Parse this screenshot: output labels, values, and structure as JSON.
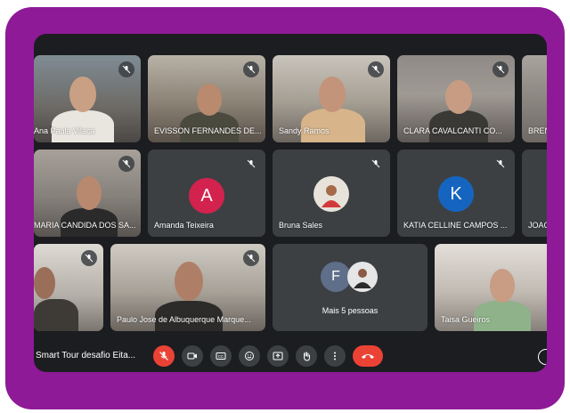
{
  "participants": {
    "row1": [
      {
        "name": "Ana Paula Vilaca"
      },
      {
        "name": "EVISSON FERNANDES DE..."
      },
      {
        "name": "Sandy Ramos"
      },
      {
        "name": "CLARA CAVALCANTI CO..."
      },
      {
        "name": "BREN"
      }
    ],
    "row2": [
      {
        "name": "MARIA CANDIDA DOS SA..."
      },
      {
        "name": "Amanda Teixeira",
        "initial": "A",
        "avatar_color": "#d3224e"
      },
      {
        "name": "Bruna Sales"
      },
      {
        "name": "KATIA CELLINE CAMPOS ...",
        "initial": "K",
        "avatar_color": "#1565c0"
      },
      {
        "name": "JOAO"
      }
    ],
    "row3": [
      {
        "name": ""
      },
      {
        "name": "Paulo Jose de Albuquerque Marque..."
      },
      {
        "name": "Taisa Gueiros"
      }
    ],
    "more": {
      "initial": "F",
      "label": "Mais 5 pessoas",
      "avatar_color": "#5f6f8a"
    }
  },
  "controls": {
    "meeting_title": "Smart Tour desafio Eita...",
    "buttons": [
      "mic-off-icon",
      "camera-icon",
      "captions-icon",
      "emoji-icon",
      "present-icon",
      "raise-hand-icon",
      "more-options-icon",
      "end-call-icon"
    ],
    "accent_red": "#ea4335"
  },
  "frame_color": "#8e1a97"
}
